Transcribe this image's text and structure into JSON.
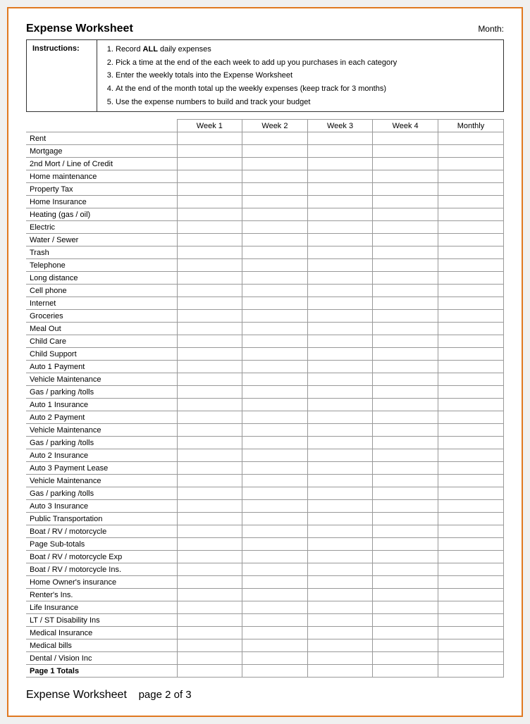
{
  "header": {
    "title": "Expense Worksheet",
    "month_label": "Month:"
  },
  "instructions": {
    "label": "Instructions:",
    "steps": [
      {
        "text": "Record ",
        "bold": "ALL",
        "rest": " daily expenses"
      },
      {
        "text": "Pick a time at the end of the each week to add up you purchases in each category"
      },
      {
        "text": "Enter the weekly totals into the Expense Worksheet"
      },
      {
        "text": "At the end of the month total up the weekly expenses (keep track for 3 months)"
      },
      {
        "text": "Use the expense numbers to build and track your budget"
      }
    ]
  },
  "columns": [
    "Week 1",
    "Week 2",
    "Week 3",
    "Week 4",
    "Monthly"
  ],
  "rows": [
    {
      "label": "Rent",
      "bold": false
    },
    {
      "label": "Mortgage",
      "bold": false
    },
    {
      "label": "2nd Mort / Line of Credit",
      "bold": false
    },
    {
      "label": "Home maintenance",
      "bold": false
    },
    {
      "label": "Property Tax",
      "bold": false
    },
    {
      "label": "Home Insurance",
      "bold": false
    },
    {
      "label": "Heating (gas / oil)",
      "bold": false
    },
    {
      "label": "Electric",
      "bold": false
    },
    {
      "label": "Water / Sewer",
      "bold": false
    },
    {
      "label": "Trash",
      "bold": false
    },
    {
      "label": "Telephone",
      "bold": false
    },
    {
      "label": "Long distance",
      "bold": false
    },
    {
      "label": "Cell phone",
      "bold": false
    },
    {
      "label": "Internet",
      "bold": false
    },
    {
      "label": "Groceries",
      "bold": false
    },
    {
      "label": "Meal Out",
      "bold": false
    },
    {
      "label": "Child Care",
      "bold": false
    },
    {
      "label": "Child Support",
      "bold": false
    },
    {
      "label": "Auto 1 Payment",
      "bold": false
    },
    {
      "label": "Vehicle Maintenance",
      "bold": false
    },
    {
      "label": "Gas / parking /tolls",
      "bold": false
    },
    {
      "label": "Auto 1 Insurance",
      "bold": false
    },
    {
      "label": "Auto 2 Payment",
      "bold": false
    },
    {
      "label": "Vehicle Maintenance",
      "bold": false
    },
    {
      "label": "Gas / parking /tolls",
      "bold": false
    },
    {
      "label": "Auto 2 Insurance",
      "bold": false
    },
    {
      "label": "Auto 3 Payment Lease",
      "bold": false
    },
    {
      "label": "Vehicle Maintenance",
      "bold": false
    },
    {
      "label": "Gas / parking /tolls",
      "bold": false
    },
    {
      "label": "Auto 3 Insurance",
      "bold": false
    },
    {
      "label": "Public Transportation",
      "bold": false
    },
    {
      "label": "Boat / RV / motorcycle",
      "bold": false
    },
    {
      "label": "Page Sub-totals",
      "bold": false
    },
    {
      "label": "Boat / RV / motorcycle Exp",
      "bold": false
    },
    {
      "label": "Boat / RV / motorcycle Ins.",
      "bold": false
    },
    {
      "label": "Home Owner's insurance",
      "bold": false
    },
    {
      "label": "Renter's Ins.",
      "bold": false
    },
    {
      "label": "Life Insurance",
      "bold": false
    },
    {
      "label": "LT / ST Disability Ins",
      "bold": false
    },
    {
      "label": "Medical Insurance",
      "bold": false
    },
    {
      "label": "Medical bills",
      "bold": false
    },
    {
      "label": "Dental / Vision Inc",
      "bold": false
    },
    {
      "label": "Page 1 Totals",
      "bold": true
    }
  ],
  "footer": {
    "title": "Expense Worksheet",
    "page_info": "page 2 of 3"
  }
}
